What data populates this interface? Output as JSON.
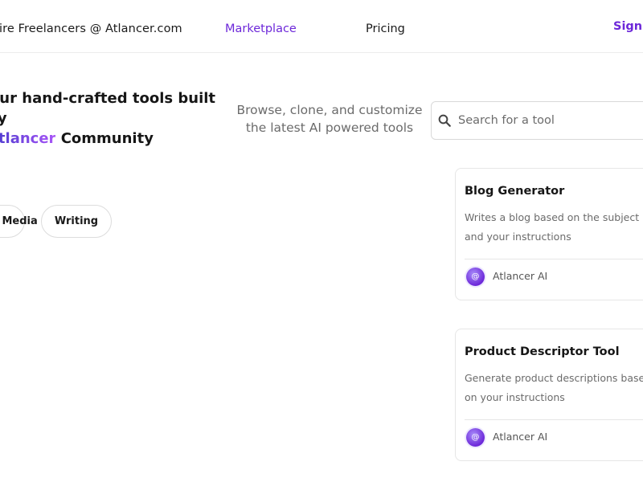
{
  "header": {
    "brand_text": "Hire Freelancers @ Atlancer.com",
    "nav_marketplace": "Marketplace",
    "nav_pricing": "Pricing",
    "sign_in": "Sign In"
  },
  "hero": {
    "title_line1": "Our hand-crafted tools built by",
    "title_brand": "Atlancer",
    "title_end": "Community",
    "subtitle": "Browse, clone, and customize the latest AI powered tools"
  },
  "search": {
    "placeholder": "Search for a tool",
    "icon": "search-icon"
  },
  "categories": [
    "Social Media",
    "Writing"
  ],
  "cards": [
    {
      "title": "Blog Generator",
      "description": "Writes a blog based on the subject and your instructions",
      "author": "Atlancer AI",
      "avatar_icon": "at-sign-icon"
    },
    {
      "title": "Product Descriptor Tool",
      "description": "Generate product descriptions based on your instructions",
      "author": "Atlancer AI",
      "avatar_icon": "at-sign-icon"
    }
  ],
  "colors": {
    "accent": "#6d28d9",
    "brand_gradient_start": "#4338ca",
    "brand_gradient_end": "#a855f7"
  }
}
